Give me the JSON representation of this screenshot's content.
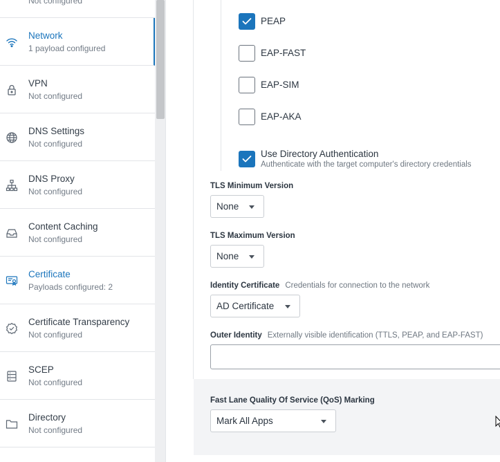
{
  "sidebar": {
    "top_partial_sub": "Not configured",
    "items": [
      {
        "title": "Network",
        "sub": "1 payload configured",
        "icon": "wifi-icon"
      },
      {
        "title": "VPN",
        "sub": "Not configured",
        "icon": "lock-icon"
      },
      {
        "title": "DNS Settings",
        "sub": "Not configured",
        "icon": "globe-icon"
      },
      {
        "title": "DNS Proxy",
        "sub": "Not configured",
        "icon": "hierarchy-icon"
      },
      {
        "title": "Content Caching",
        "sub": "Not configured",
        "icon": "tray-icon"
      },
      {
        "title": "Certificate",
        "sub": "Payloads configured: 2",
        "icon": "certificate-icon"
      },
      {
        "title": "Certificate Transparency",
        "sub": "Not configured",
        "icon": "check-badge-icon"
      },
      {
        "title": "SCEP",
        "sub": "Not configured",
        "icon": "scep-icon"
      },
      {
        "title": "Directory",
        "sub": "Not configured",
        "icon": "folder-icon"
      }
    ]
  },
  "eap": {
    "peap": {
      "label": "PEAP",
      "checked": true
    },
    "eap_fast": {
      "label": "EAP-FAST",
      "checked": false
    },
    "eap_sim": {
      "label": "EAP-SIM",
      "checked": false
    },
    "eap_aka": {
      "label": "EAP-AKA",
      "checked": false
    }
  },
  "directory_auth": {
    "label": "Use Directory Authentication",
    "sub": "Authenticate with the target computer's directory credentials",
    "checked": true
  },
  "tls_min": {
    "label": "TLS Minimum Version",
    "value": "None"
  },
  "tls_max": {
    "label": "TLS Maximum Version",
    "value": "None"
  },
  "identity_cert": {
    "label": "Identity Certificate",
    "hint": "Credentials for connection to the network",
    "value": "AD Certificate"
  },
  "outer_identity": {
    "label": "Outer Identity",
    "hint": "Externally visible identification (TTLS, PEAP, and EAP-FAST)",
    "value": ""
  },
  "qos": {
    "label": "Fast Lane Quality Of Service (QoS) Marking",
    "value": "Mark All Apps"
  },
  "colors": {
    "accent": "#1b75bc",
    "band": "#f3f4f6"
  }
}
